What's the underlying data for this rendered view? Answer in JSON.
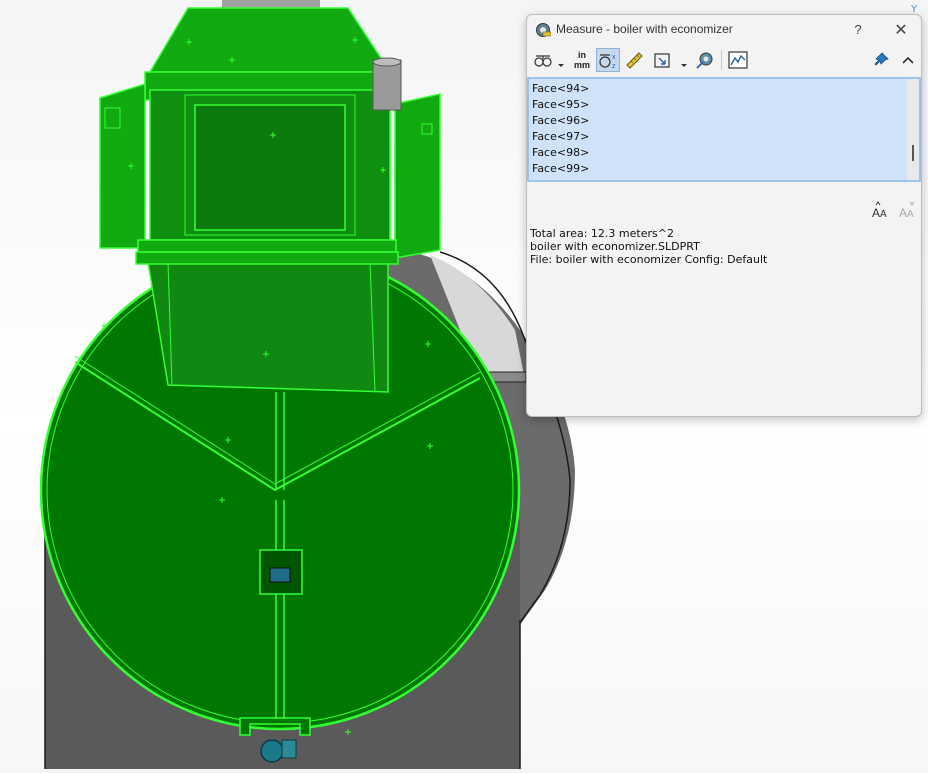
{
  "dialog": {
    "title": "Measure - boiler with economizer",
    "help_label": "?",
    "units_label_top": "in",
    "units_label_bottom": "mm",
    "selection_items": [
      "Face<94>",
      "Face<95>",
      "Face<96>",
      "Face<97>",
      "Face<98>",
      "Face<99>"
    ],
    "results": [
      "Total area: 12.3 meters^2",
      "boiler with economizer.SLDPRT",
      "File: boiler with economizer Config: Default"
    ]
  },
  "viewport": {
    "triad_label": "Y",
    "selection_color": "#00ff00",
    "face_fill_color": "#008000",
    "body_color": "#5a5a5a"
  },
  "toolbar_icons": [
    "arc-circle-measure-icon",
    "units-precision-icon",
    "show-xyz-icon",
    "point-to-point-icon",
    "projection-icon",
    "measurement-history-icon",
    "create-sensor-icon",
    "pin-icon",
    "collapse-icon"
  ]
}
